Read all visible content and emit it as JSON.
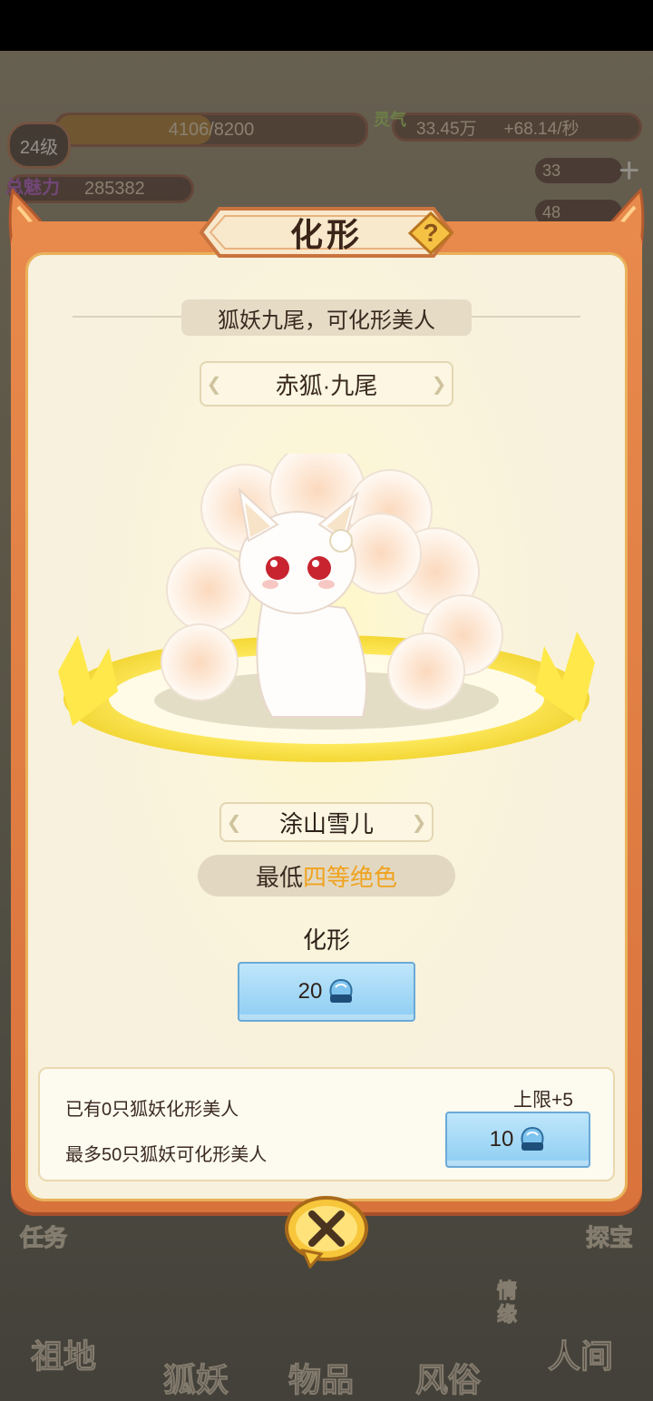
{
  "hud": {
    "level": "24级",
    "exp": "4106/8200",
    "exp_fraction": 0.5,
    "lingqi_amount": "33.45万",
    "lingqi_rate": "+68.14/秒",
    "charm_value": "285382",
    "resource1": "33",
    "resource2": "48"
  },
  "bottom_nav": {
    "items": [
      "祖地",
      "狐妖",
      "物品",
      "风俗",
      "人间"
    ],
    "left_side": "任务",
    "right_side": "探宝",
    "emotion": "情缘"
  },
  "modal": {
    "title": "化形",
    "subtitle": "狐妖九尾，可化形美人",
    "fox_name": "赤狐·九尾",
    "beauty_name": "涂山雪儿",
    "requirement_prefix": "最低",
    "requirement_highlight": "四等绝色",
    "transform_label": "化形",
    "transform_cost": "20",
    "owned_text": "已有0只狐妖化形美人",
    "max_text": "最多50只狐妖可化形美人",
    "limit_label": "上限+5",
    "limit_cost": "10"
  },
  "colors": {
    "frame_orange": "#e88a4c",
    "panel_cream": "#f7f1dd",
    "highlight_orange": "#f0a21e",
    "button_blue": "#8dcdf2"
  },
  "icons": {
    "gem": "xianpin-gem-icon",
    "close": "close-icon",
    "help": "question-icon"
  }
}
